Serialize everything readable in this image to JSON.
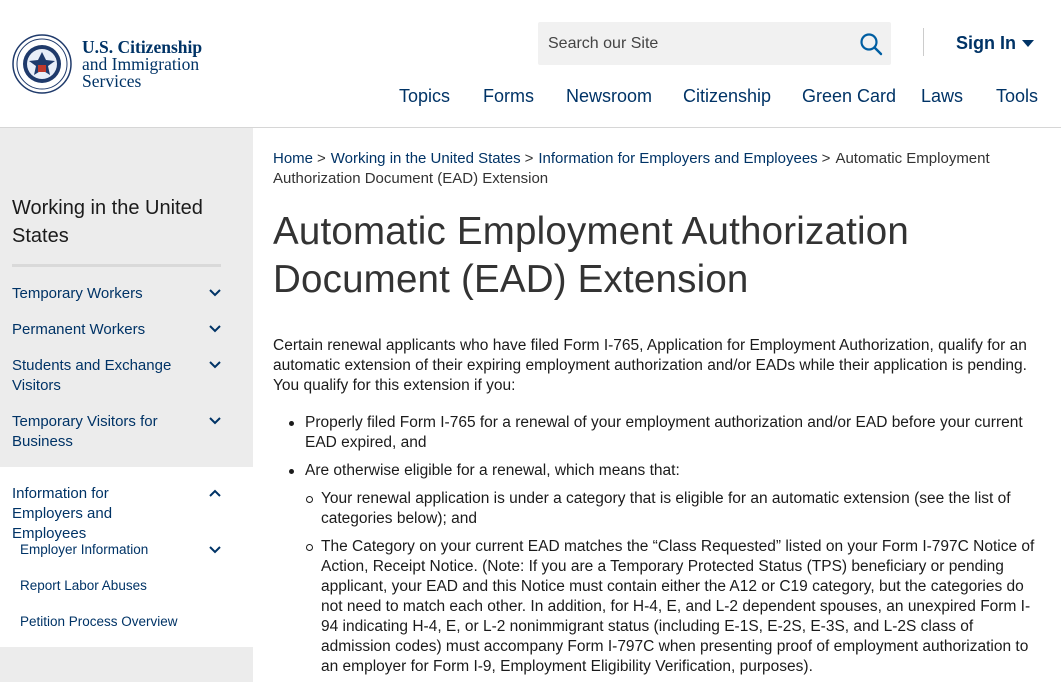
{
  "header": {
    "logo_line1": "U.S. Citizenship",
    "logo_line2": "and Immigration",
    "logo_line3": "Services",
    "search_placeholder": "Search our Site",
    "signin_label": "Sign In",
    "nav": [
      "Topics",
      "Forms",
      "Newsroom",
      "Citizenship",
      "Green Card",
      "Laws",
      "Tools"
    ]
  },
  "sidebar": {
    "title": "Working in the United States",
    "items": [
      {
        "label": "Temporary Workers",
        "icon": "chevron-down-icon"
      },
      {
        "label": "Permanent Workers",
        "icon": "chevron-down-icon"
      },
      {
        "label": "Students and Exchange Visitors",
        "icon": "chevron-down-icon"
      },
      {
        "label": "Temporary Visitors for Business",
        "icon": "chevron-down-icon"
      },
      {
        "label": "Information for Employers and Employees",
        "icon": "chevron-up-icon"
      }
    ],
    "sub_items": [
      {
        "label": "Employer Information",
        "icon": "chevron-down-icon"
      },
      {
        "label": "Report Labor Abuses"
      },
      {
        "label": "Petition Process Overview"
      }
    ]
  },
  "breadcrumb": {
    "items": [
      "Home",
      "Working in the United States",
      "Information for Employers and Employees"
    ],
    "current": "Automatic Employment Authorization Document (EAD) Extension",
    "separator": ">"
  },
  "main": {
    "title": "Automatic Employment Authorization Document (EAD) Extension",
    "intro": "Certain renewal applicants who have filed Form I-765, Application for Employment Authorization, qualify for an automatic extension of their expiring employment authorization and/or EADs while their application is pending. You qualify for this extension if you:",
    "bullets": [
      "Properly filed Form I-765 for a renewal of your employment authorization and/or EAD before your current EAD expired, and",
      "Are otherwise eligible for a renewal, which means that:"
    ],
    "sub_bullets": [
      "Your renewal application is under a category that is eligible for an automatic extension (see the list of categories below); and",
      "The Category on your current EAD matches the “Class Requested” listed on your Form I-797C Notice of Action, Receipt Notice. (Note: If you are a Temporary Protected Status (TPS) beneficiary or pending applicant, your EAD and this Notice must contain either the A12 or C19 category, but the categories do not need to match each other. In addition, for H-4, E, and L-2 dependent spouses, an unexpired Form I-94 indicating H-4, E, or L-2 nonimmigrant status (including E-1S, E-2S, E-3S, and L-2S class of admission codes) must accompany Form I-797C when presenting proof of employment authorization to an employer for Form I-9, Employment Eligibility Verification, purposes)."
    ]
  },
  "colors": {
    "brand": "#003366",
    "sidebar_bg": "#ececec",
    "search_bg": "#f1f1f1"
  }
}
